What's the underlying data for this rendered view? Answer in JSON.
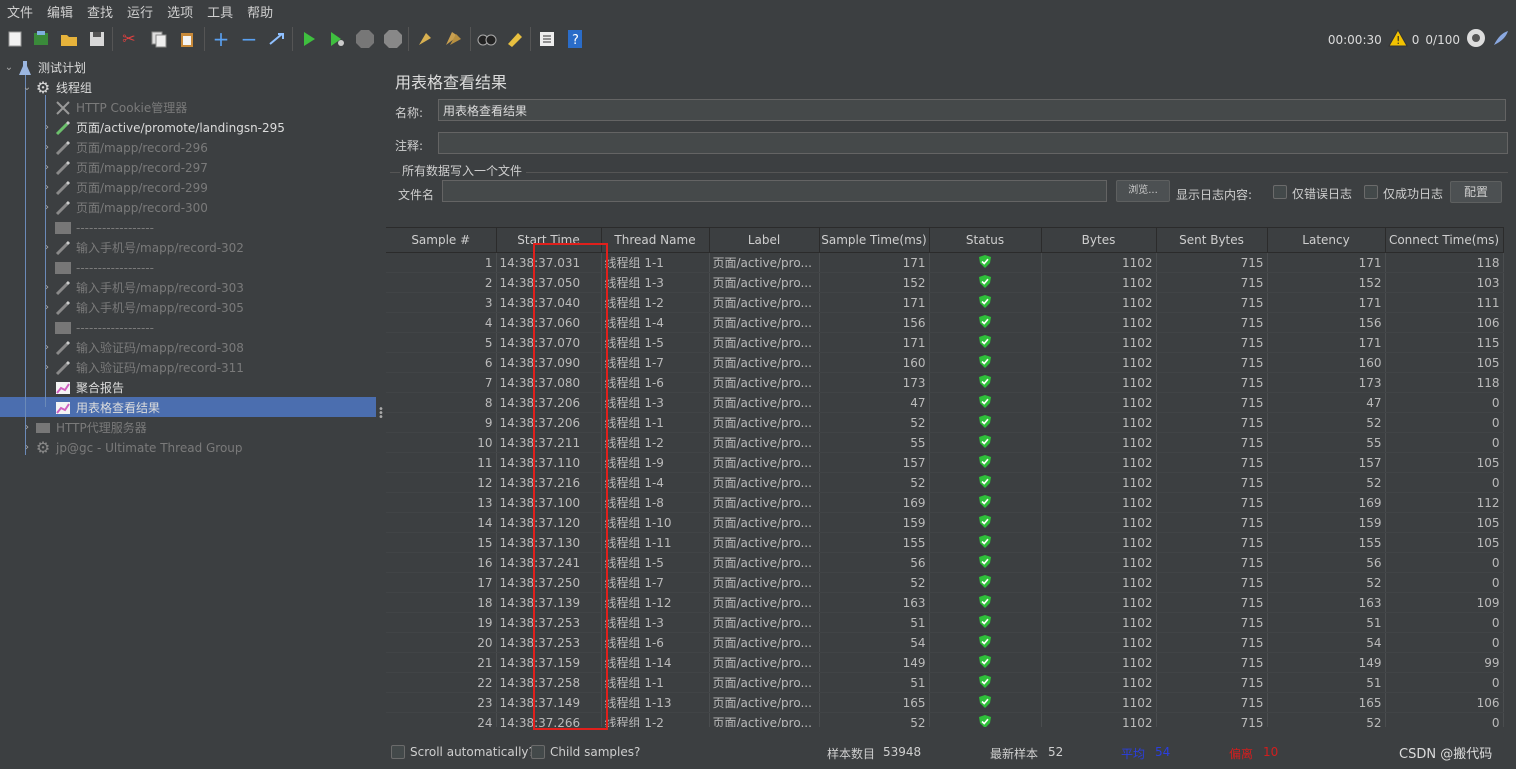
{
  "menu": [
    "文件",
    "编辑",
    "查找",
    "运行",
    "选项",
    "工具",
    "帮助"
  ],
  "status": {
    "elapsed": "00:00:30",
    "warnings": "0",
    "threads": "0/100"
  },
  "tree": {
    "root": "测试计划",
    "thread_group": "线程组",
    "items": [
      {
        "label": "HTTP Cookie管理器",
        "dim": true,
        "arrow": false,
        "icon": "wrench-icon"
      },
      {
        "label": "页面/active/promote/landingsn-295",
        "dim": false,
        "arrow": true,
        "icon": "pipette-icon"
      },
      {
        "label": "页面/mapp/record-296",
        "dim": true,
        "arrow": true,
        "icon": "pipette-icon"
      },
      {
        "label": "页面/mapp/record-297",
        "dim": true,
        "arrow": true,
        "icon": "pipette-icon"
      },
      {
        "label": "页面/mapp/record-299",
        "dim": true,
        "arrow": true,
        "icon": "pipette-icon"
      },
      {
        "label": "页面/mapp/record-300",
        "dim": true,
        "arrow": true,
        "icon": "pipette-icon"
      },
      {
        "label": "------------------",
        "dim": true,
        "arrow": false,
        "icon": "box-icon"
      },
      {
        "label": "输入手机号/mapp/record-302",
        "dim": true,
        "arrow": true,
        "icon": "pipette-icon"
      },
      {
        "label": "------------------",
        "dim": true,
        "arrow": false,
        "icon": "box-icon"
      },
      {
        "label": "输入手机号/mapp/record-303",
        "dim": true,
        "arrow": true,
        "icon": "pipette-icon"
      },
      {
        "label": "输入手机号/mapp/record-305",
        "dim": true,
        "arrow": true,
        "icon": "pipette-icon"
      },
      {
        "label": "------------------",
        "dim": true,
        "arrow": false,
        "icon": "box-icon"
      },
      {
        "label": "输入验证码/mapp/record-308",
        "dim": true,
        "arrow": true,
        "icon": "pipette-icon"
      },
      {
        "label": "输入验证码/mapp/record-311",
        "dim": true,
        "arrow": true,
        "icon": "pipette-icon"
      },
      {
        "label": "聚合报告",
        "dim": false,
        "arrow": false,
        "icon": "chart-icon"
      },
      {
        "label": "用表格查看结果",
        "dim": false,
        "arrow": false,
        "icon": "chart-icon"
      }
    ],
    "proxy": "HTTP代理服务器",
    "ultimate": "jp@gc - Ultimate Thread Group"
  },
  "panel": {
    "title": "用表格查看结果",
    "name_label": "名称:",
    "name_value": "用表格查看结果",
    "comment_label": "注释:",
    "comment_value": "",
    "fileset_label": "所有数据写入一个文件",
    "filename_label": "文件名",
    "filename_value": "",
    "browse": "浏览...",
    "log_label": "显示日志内容:",
    "errors_only": "仅错误日志",
    "success_only": "仅成功日志",
    "configure": "配置"
  },
  "columns": [
    "Sample #",
    "Start Time",
    "Thread Name",
    "Label",
    "Sample Time(ms)",
    "Status",
    "Bytes",
    "Sent Bytes",
    "Latency",
    "Connect Time(ms)"
  ],
  "rows": [
    [
      "1",
      "14:38:37.031",
      "线程组 1-1",
      "页面/active/pro...",
      "171",
      "ok",
      "1102",
      "715",
      "171",
      "118"
    ],
    [
      "2",
      "14:38:37.050",
      "线程组 1-3",
      "页面/active/pro...",
      "152",
      "ok",
      "1102",
      "715",
      "152",
      "103"
    ],
    [
      "3",
      "14:38:37.040",
      "线程组 1-2",
      "页面/active/pro...",
      "171",
      "ok",
      "1102",
      "715",
      "171",
      "111"
    ],
    [
      "4",
      "14:38:37.060",
      "线程组 1-4",
      "页面/active/pro...",
      "156",
      "ok",
      "1102",
      "715",
      "156",
      "106"
    ],
    [
      "5",
      "14:38:37.070",
      "线程组 1-5",
      "页面/active/pro...",
      "171",
      "ok",
      "1102",
      "715",
      "171",
      "115"
    ],
    [
      "6",
      "14:38:37.090",
      "线程组 1-7",
      "页面/active/pro...",
      "160",
      "ok",
      "1102",
      "715",
      "160",
      "105"
    ],
    [
      "7",
      "14:38:37.080",
      "线程组 1-6",
      "页面/active/pro...",
      "173",
      "ok",
      "1102",
      "715",
      "173",
      "118"
    ],
    [
      "8",
      "14:38:37.206",
      "线程组 1-3",
      "页面/active/pro...",
      "47",
      "ok",
      "1102",
      "715",
      "47",
      "0"
    ],
    [
      "9",
      "14:38:37.206",
      "线程组 1-1",
      "页面/active/pro...",
      "52",
      "ok",
      "1102",
      "715",
      "52",
      "0"
    ],
    [
      "10",
      "14:38:37.211",
      "线程组 1-2",
      "页面/active/pro...",
      "55",
      "ok",
      "1102",
      "715",
      "55",
      "0"
    ],
    [
      "11",
      "14:38:37.110",
      "线程组 1-9",
      "页面/active/pro...",
      "157",
      "ok",
      "1102",
      "715",
      "157",
      "105"
    ],
    [
      "12",
      "14:38:37.216",
      "线程组 1-4",
      "页面/active/pro...",
      "52",
      "ok",
      "1102",
      "715",
      "52",
      "0"
    ],
    [
      "13",
      "14:38:37.100",
      "线程组 1-8",
      "页面/active/pro...",
      "169",
      "ok",
      "1102",
      "715",
      "169",
      "112"
    ],
    [
      "14",
      "14:38:37.120",
      "线程组 1-10",
      "页面/active/pro...",
      "159",
      "ok",
      "1102",
      "715",
      "159",
      "105"
    ],
    [
      "15",
      "14:38:37.130",
      "线程组 1-11",
      "页面/active/pro...",
      "155",
      "ok",
      "1102",
      "715",
      "155",
      "105"
    ],
    [
      "16",
      "14:38:37.241",
      "线程组 1-5",
      "页面/active/pro...",
      "56",
      "ok",
      "1102",
      "715",
      "56",
      "0"
    ],
    [
      "17",
      "14:38:37.250",
      "线程组 1-7",
      "页面/active/pro...",
      "52",
      "ok",
      "1102",
      "715",
      "52",
      "0"
    ],
    [
      "18",
      "14:38:37.139",
      "线程组 1-12",
      "页面/active/pro...",
      "163",
      "ok",
      "1102",
      "715",
      "163",
      "109"
    ],
    [
      "19",
      "14:38:37.253",
      "线程组 1-3",
      "页面/active/pro...",
      "51",
      "ok",
      "1102",
      "715",
      "51",
      "0"
    ],
    [
      "20",
      "14:38:37.253",
      "线程组 1-6",
      "页面/active/pro...",
      "54",
      "ok",
      "1102",
      "715",
      "54",
      "0"
    ],
    [
      "21",
      "14:38:37.159",
      "线程组 1-14",
      "页面/active/pro...",
      "149",
      "ok",
      "1102",
      "715",
      "149",
      "99"
    ],
    [
      "22",
      "14:38:37.258",
      "线程组 1-1",
      "页面/active/pro...",
      "51",
      "ok",
      "1102",
      "715",
      "51",
      "0"
    ],
    [
      "23",
      "14:38:37.149",
      "线程组 1-13",
      "页面/active/pro...",
      "165",
      "ok",
      "1102",
      "715",
      "165",
      "106"
    ],
    [
      "24",
      "14:38:37.266",
      "线程组 1-2",
      "页面/active/pro...",
      "52",
      "ok",
      "1102",
      "715",
      "52",
      "0"
    ]
  ],
  "footer": {
    "scroll_auto": "Scroll automatically?",
    "child_samples": "Child samples?",
    "samples_label": "样本数目",
    "samples_value": "53948",
    "latest_label": "最新样本",
    "latest_value": "52",
    "avg_label": "平均",
    "avg_value": "54",
    "dev_label": "偏离",
    "dev_value": "10",
    "watermark": "CSDN @搬代码"
  },
  "colors": {
    "selection": "#4b6eaf",
    "highlight": "#e0201c",
    "avg": "#2a3fe0",
    "dev": "#d21e1e",
    "ok": "#2fbf3a"
  }
}
